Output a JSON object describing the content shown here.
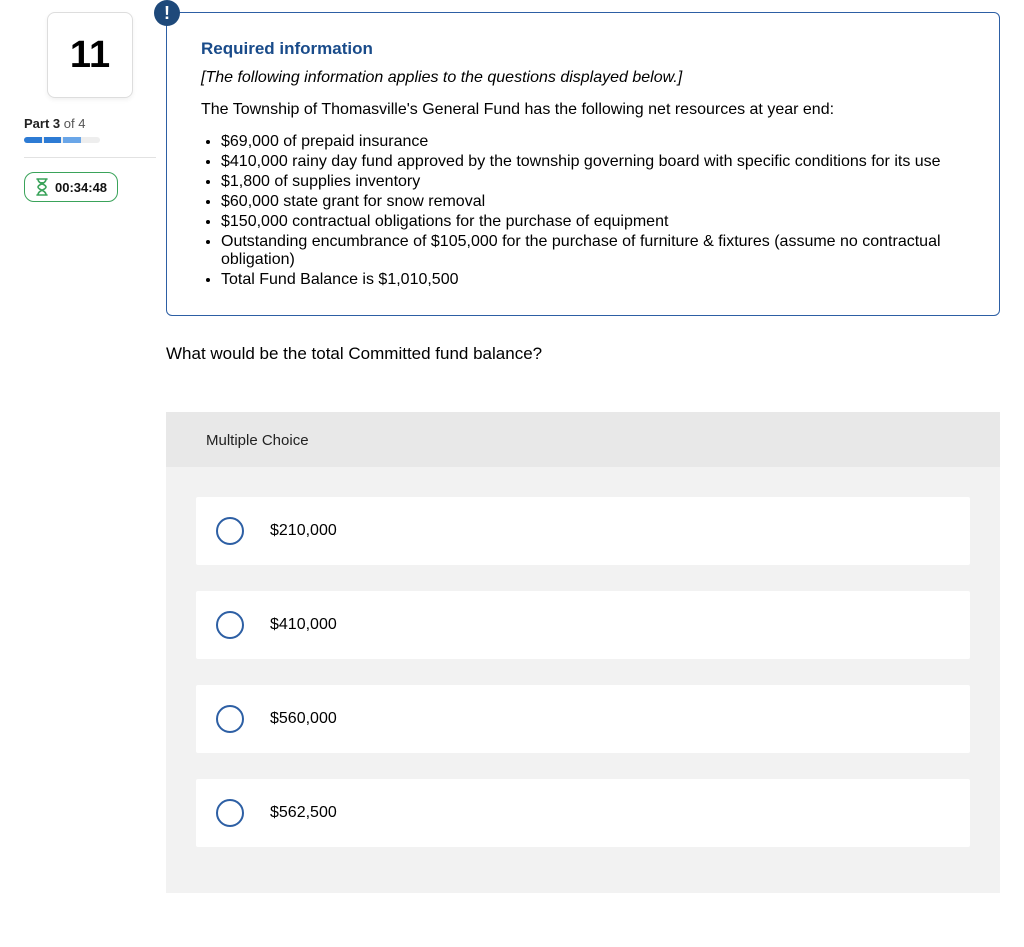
{
  "sidebar": {
    "question_number": "11",
    "part_label": {
      "bold": "Part 3",
      "rest": " of 4"
    },
    "timer": "00:34:48"
  },
  "info": {
    "badge": "!",
    "title": "Required information",
    "subtitle": "[The following information applies to the questions displayed below.]",
    "intro": "The Township of Thomasville's General Fund has the following net resources at year end:",
    "bullets": [
      "$69,000 of prepaid insurance",
      "$410,000 rainy day fund approved by the township governing board with specific conditions for its use",
      "$1,800 of supplies inventory",
      "$60,000 state grant for snow removal",
      "$150,000 contractual obligations for the purchase of equipment",
      "Outstanding encumbrance of $105,000 for the purchase of furniture & fixtures (assume no contractual obligation)",
      "Total Fund Balance is $1,010,500"
    ]
  },
  "question": "What would be the total Committed fund balance?",
  "mc": {
    "header": "Multiple Choice",
    "options": [
      "$210,000",
      "$410,000",
      "$560,000",
      "$562,500"
    ]
  }
}
